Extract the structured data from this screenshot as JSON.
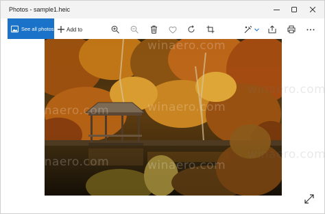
{
  "window": {
    "title": "Photos - sample1.heic"
  },
  "toolbar": {
    "see_all_label": "See all photos",
    "add_to_label": "Add to",
    "icons": [
      "zoom-in-icon",
      "zoom-out-icon",
      "delete-icon",
      "favorite-icon",
      "rotate-icon",
      "crop-icon",
      "edit-icon",
      "share-icon",
      "print-icon",
      "more-icon"
    ]
  },
  "watermark": "winaero.com",
  "colors": {
    "accent": "#1a73c8",
    "titlebar": "#f3f3f3"
  }
}
